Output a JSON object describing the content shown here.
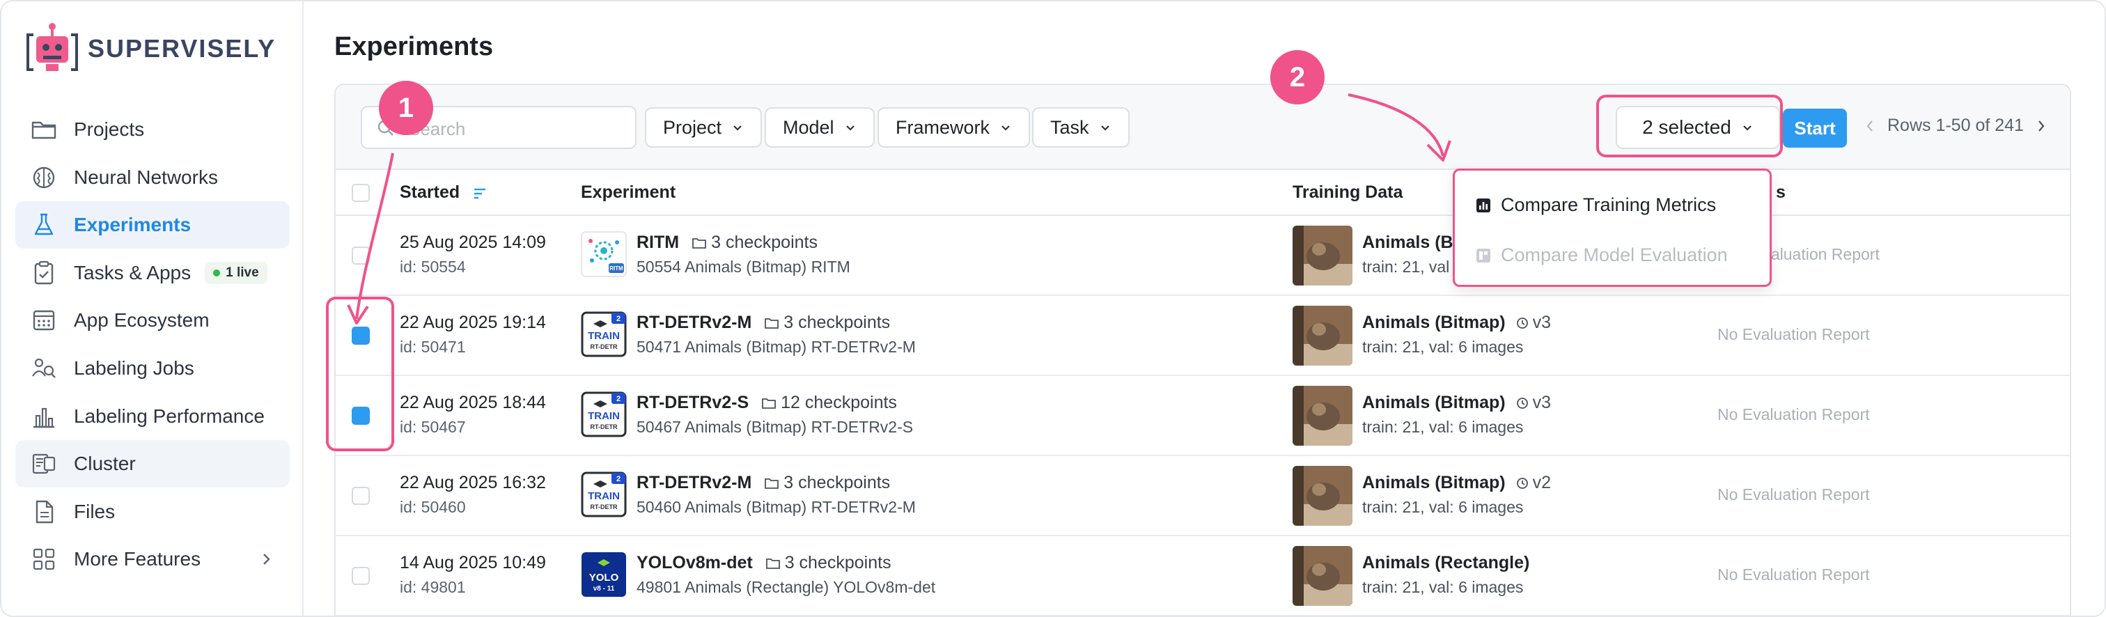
{
  "app": {
    "name": "SUPERVISELY"
  },
  "sidebar": {
    "items": [
      {
        "label": "Projects",
        "icon": "folder-icon"
      },
      {
        "label": "Neural Networks",
        "icon": "brain-icon"
      },
      {
        "label": "Experiments",
        "icon": "flask-icon",
        "active": true
      },
      {
        "label": "Tasks & Apps",
        "icon": "clipboard-check-icon",
        "badge": "1 live"
      },
      {
        "label": "App Ecosystem",
        "icon": "app-grid-icon"
      },
      {
        "label": "Labeling Jobs",
        "icon": "people-search-icon"
      },
      {
        "label": "Labeling Performance",
        "icon": "bar-chart-icon"
      },
      {
        "label": "Cluster",
        "icon": "cluster-icon"
      },
      {
        "label": "Files",
        "icon": "file-icon"
      },
      {
        "label": "More Features",
        "icon": "grid-icon"
      }
    ]
  },
  "page": {
    "title": "Experiments"
  },
  "toolbar": {
    "search_placeholder": "Search",
    "filters": [
      "Project",
      "Model",
      "Framework",
      "Task"
    ],
    "selected_label": "2 selected",
    "start_label": "Start",
    "pagination": "Rows 1-50 of 241"
  },
  "table": {
    "headers": {
      "started": "Started",
      "experiment": "Experiment",
      "training_data": "Training Data",
      "evaluation": "s"
    },
    "rows": [
      {
        "started": "25 Aug 2025 14:09",
        "id": "id: 50554",
        "name": "RITM",
        "checkpoints": "3 checkpoints",
        "sub": "50554 Animals (Bitmap) RITM",
        "thumb": "ritm",
        "data_name": "Animals (Bit",
        "version": "",
        "data_sub": "train: 21,  val",
        "eval": "Evaluation Report",
        "checked": false
      },
      {
        "started": "22 Aug 2025 19:14",
        "id": "id: 50471",
        "name": "RT-DETRv2-M",
        "checkpoints": "3 checkpoints",
        "sub": "50471 Animals (Bitmap) RT-DETRv2-M",
        "thumb": "train",
        "data_name": "Animals (Bitmap)",
        "version": "v3",
        "data_sub": "train: 21, val: 6 images",
        "eval": "No Evaluation Report",
        "checked": true
      },
      {
        "started": "22 Aug 2025 18:44",
        "id": "id: 50467",
        "name": "RT-DETRv2-S",
        "checkpoints": "12 checkpoints",
        "sub": "50467 Animals (Bitmap) RT-DETRv2-S",
        "thumb": "train",
        "data_name": "Animals (Bitmap)",
        "version": "v3",
        "data_sub": "train: 21, val: 6 images",
        "eval": "No Evaluation Report",
        "checked": true
      },
      {
        "started": "22 Aug 2025 16:32",
        "id": "id: 50460",
        "name": "RT-DETRv2-M",
        "checkpoints": "3 checkpoints",
        "sub": "50460 Animals (Bitmap) RT-DETRv2-M",
        "thumb": "train",
        "data_name": "Animals (Bitmap)",
        "version": "v2",
        "data_sub": "train: 21, val: 6 images",
        "eval": "No Evaluation Report",
        "checked": false
      },
      {
        "started": "14 Aug 2025 10:49",
        "id": "id: 49801",
        "name": "YOLOv8m-det",
        "checkpoints": "3 checkpoints",
        "sub": "49801 Animals (Rectangle) YOLOv8m-det",
        "thumb": "yolo",
        "data_name": "Animals (Rectangle)",
        "version": "",
        "data_sub": "train: 21,  val: 6 images",
        "eval": "No Evaluation Report",
        "checked": false
      }
    ]
  },
  "thumb_labels": {
    "ritm": "RITM",
    "train_top": "TRAIN",
    "train_bottom": "RT-DETR",
    "train_corner": "2",
    "yolo_top": "YOLO",
    "yolo_bottom": "v8 - 11"
  },
  "dropdown": {
    "items": [
      {
        "label": "Compare Training Metrics",
        "enabled": true
      },
      {
        "label": "Compare Model Evaluation",
        "enabled": false
      }
    ]
  },
  "annotations": {
    "step1": "1",
    "step2": "2",
    "color": "#f0528a"
  },
  "colors": {
    "accent": "#2d9bf0",
    "active_nav_bg": "#eef3fb",
    "highlight": "#f0528a"
  }
}
